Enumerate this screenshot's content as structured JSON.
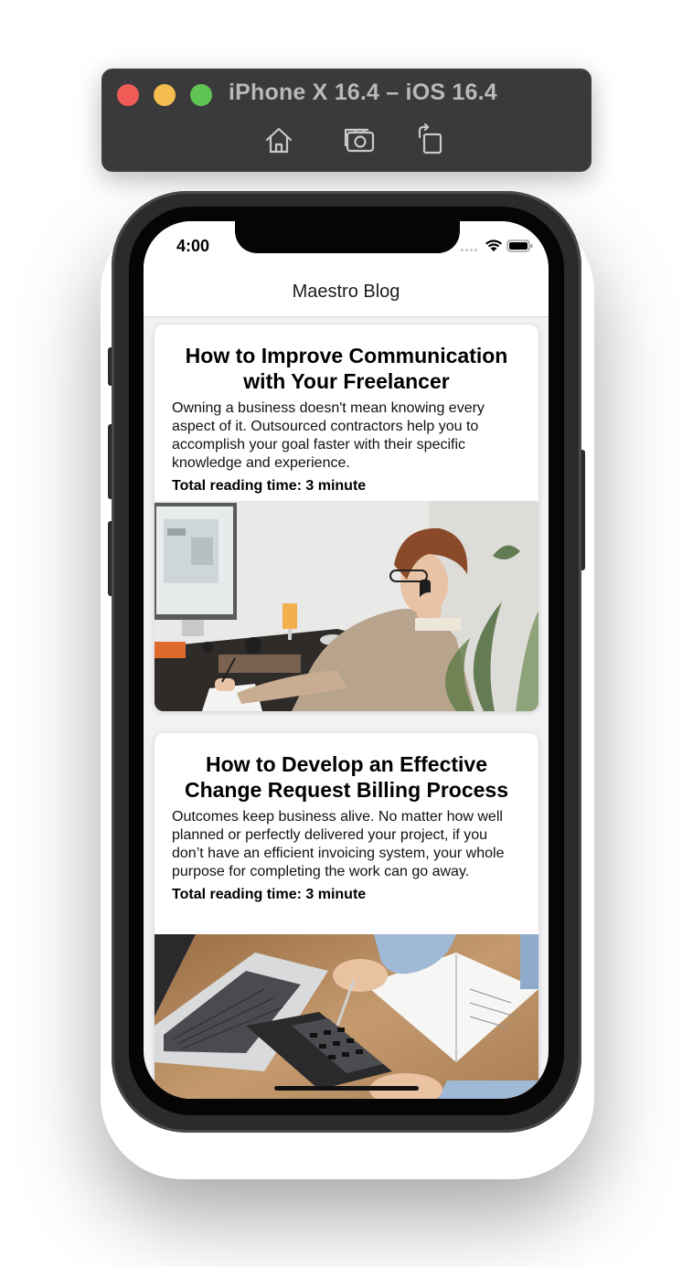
{
  "simulator": {
    "title": "iPhone X 16.4 – iOS 16.4",
    "buttons": [
      "home-icon",
      "screenshot-icon",
      "rotate-icon"
    ]
  },
  "status_bar": {
    "time": "4:00",
    "icons": [
      "signal-icon",
      "wifi-icon",
      "battery-icon"
    ]
  },
  "nav": {
    "title": "Maestro Blog"
  },
  "posts": [
    {
      "title": "How to Improve Communication with Your Freelancer",
      "excerpt": "Owning a business doesn't mean knowing every aspect of it. Outsourced contractors help you to accomplish your goal faster with their specific knowledge and experience.",
      "reading_time": "Total reading time: 3 minute",
      "image": "woman-on-phone-at-desk-photo"
    },
    {
      "title": "How to Develop an Effective Change Request Billing Process",
      "excerpt": "Outcomes keep business alive. No matter how well planned or perfectly delivered your project, if you don’t have an efficient invoicing system, your whole purpose for completing the work can go away.",
      "reading_time": "Total reading time: 3 minute",
      "image": "laptop-and-calculator-photo"
    }
  ],
  "colors": {
    "toolbar_bg": "#3a3a3c",
    "close": "#ee5c55",
    "minimize": "#f4bd4f",
    "maximize": "#60c454",
    "screen_bg": "#f2f2f4"
  }
}
